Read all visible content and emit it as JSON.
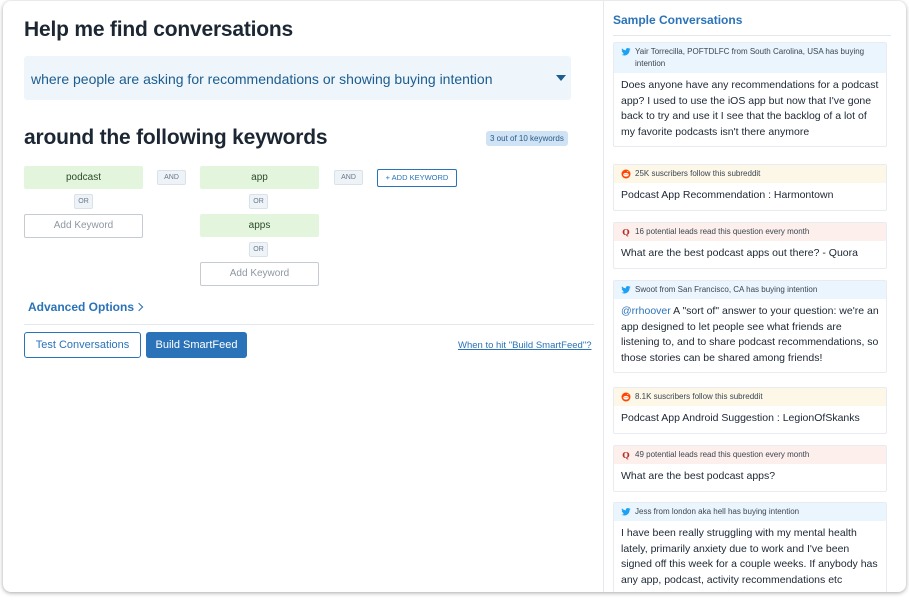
{
  "main": {
    "title": "Help me find conversations",
    "intent": "where people are asking for recommendations or showing buying intention",
    "keywords_title": "around the following keywords",
    "keyword_count": "3 out of 10 keywords",
    "groups": [
      {
        "keywords": [
          "podcast"
        ],
        "or_label": "OR",
        "add_placeholder": "Add Keyword"
      },
      {
        "keywords": [
          "app",
          "apps"
        ],
        "or_label": "OR",
        "add_placeholder": "Add Keyword"
      }
    ],
    "and_label": "AND",
    "add_keyword_button": "+ ADD KEYWORD",
    "advanced_options": "Advanced Options",
    "test_button": "Test Conversations",
    "build_button": "Build SmartFeed",
    "when_link": "When to hit \"Build SmartFeed\"?"
  },
  "sidebar": {
    "title": "Sample Conversations",
    "cards": [
      {
        "source": "twitter",
        "header": "Yair Torrecilla, POFTDLFC from South Carolina, USA has buying intention",
        "body": "Does anyone have any recommendations for a podcast app? I used to use the iOS app but now that I've gone back to try and use it I see that the backlog of a lot of my favorite podcasts isn't there anymore"
      },
      {
        "source": "reddit",
        "header": "25K suscribers follow this subreddit",
        "body": "Podcast App Recommendation : Harmontown"
      },
      {
        "source": "quora",
        "header": "16 potential leads read this question every month",
        "body": "What are the best podcast apps out there? - Quora"
      },
      {
        "source": "twitter",
        "header": "Swoot from San Francisco, CA has buying intention",
        "mention": "@rrhoover",
        "body": " A \"sort of\" answer to your question: we're an app designed to let people see what friends are listening to, and to share podcast recommendations, so those stories can be shared among friends!"
      },
      {
        "source": "reddit",
        "header": "8.1K suscribers follow this subreddit",
        "body": "Podcast App Android Suggestion : LegionOfSkanks"
      },
      {
        "source": "quora",
        "header": "49 potential leads read this question every month",
        "body": "What are the best podcast apps?"
      },
      {
        "source": "twitter",
        "header": "Jess from london aka hell has buying intention",
        "body": "I have been really struggling with my mental health lately, primarily anxiety due to work and I've been signed off this week for a couple weeks. If anybody has any app, podcast, activity recommendations etc"
      }
    ]
  },
  "colors": {
    "accent": "#2a73b8",
    "keyword_bg": "#e4f5de",
    "twitter": "#1da1f2",
    "reddit": "#ff4500",
    "quora": "#b92b27"
  }
}
